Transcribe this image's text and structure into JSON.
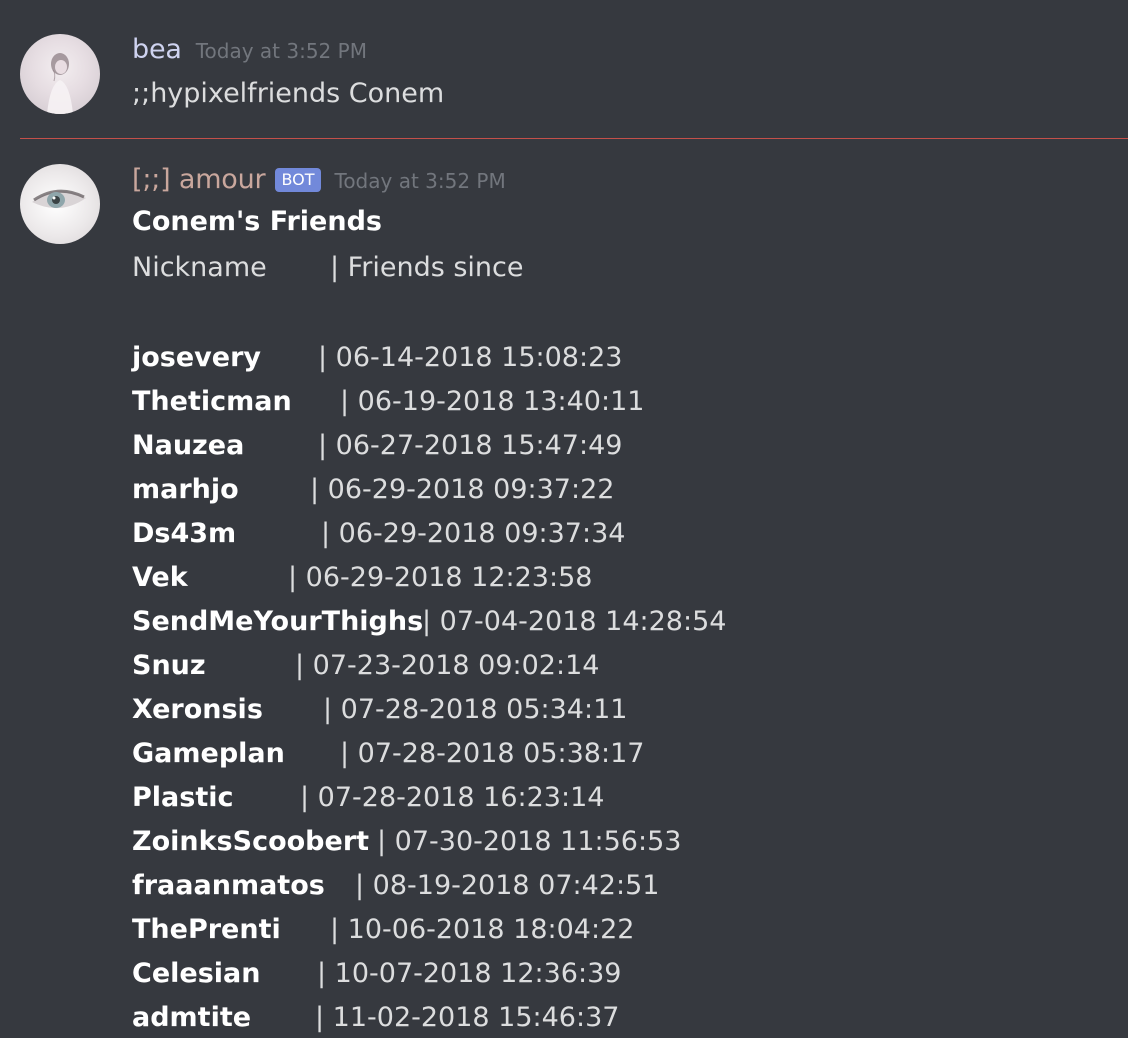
{
  "messages": [
    {
      "username": "bea",
      "timestamp": "Today at 3:52 PM",
      "content": ";;hypixelfriends Conem"
    },
    {
      "username": "[;;] amour",
      "bot_tag": "BOT",
      "timestamp": "Today at 3:52 PM",
      "embed_title": "Conem's Friends",
      "header_nickname": "Nickname",
      "header_since": "| Friends since"
    }
  ],
  "friends": [
    {
      "name": "josevery",
      "since": "| 06-14-2018 15:08:23"
    },
    {
      "name": "Theticman",
      "since": "| 06-19-2018 13:40:11"
    },
    {
      "name": "Nauzea",
      "since": "| 06-27-2018 15:47:49"
    },
    {
      "name": "marhjo",
      "since": "| 06-29-2018 09:37:22"
    },
    {
      "name": "Ds43m",
      "since": "| 06-29-2018 09:37:34"
    },
    {
      "name": "Vek",
      "since": "| 06-29-2018 12:23:58"
    },
    {
      "name": "SendMeYourThighs",
      "since": "| 07-04-2018 14:28:54"
    },
    {
      "name": "Snuz",
      "since": "| 07-23-2018 09:02:14"
    },
    {
      "name": "Xeronsis",
      "since": "| 07-28-2018 05:34:11"
    },
    {
      "name": "Gameplan",
      "since": "| 07-28-2018 05:38:17"
    },
    {
      "name": "Plastic",
      "since": "| 07-28-2018 16:23:14"
    },
    {
      "name": "ZoinksScoobert",
      "since": "| 07-30-2018 11:56:53"
    },
    {
      "name": "fraaanmatos",
      "since": "| 08-19-2018 07:42:51"
    },
    {
      "name": "ThePrenti",
      "since": "| 10-06-2018 18:04:22"
    },
    {
      "name": "Celesian",
      "since": "| 10-07-2018 12:36:39"
    },
    {
      "name": "admtite",
      "since": "| 11-02-2018 15:46:37"
    }
  ],
  "colors": {
    "background": "#36393f",
    "text": "#dcddde",
    "timestamp": "#72767d",
    "bot_tag": "#7289da",
    "new_messages_divider": "#c4504a"
  }
}
